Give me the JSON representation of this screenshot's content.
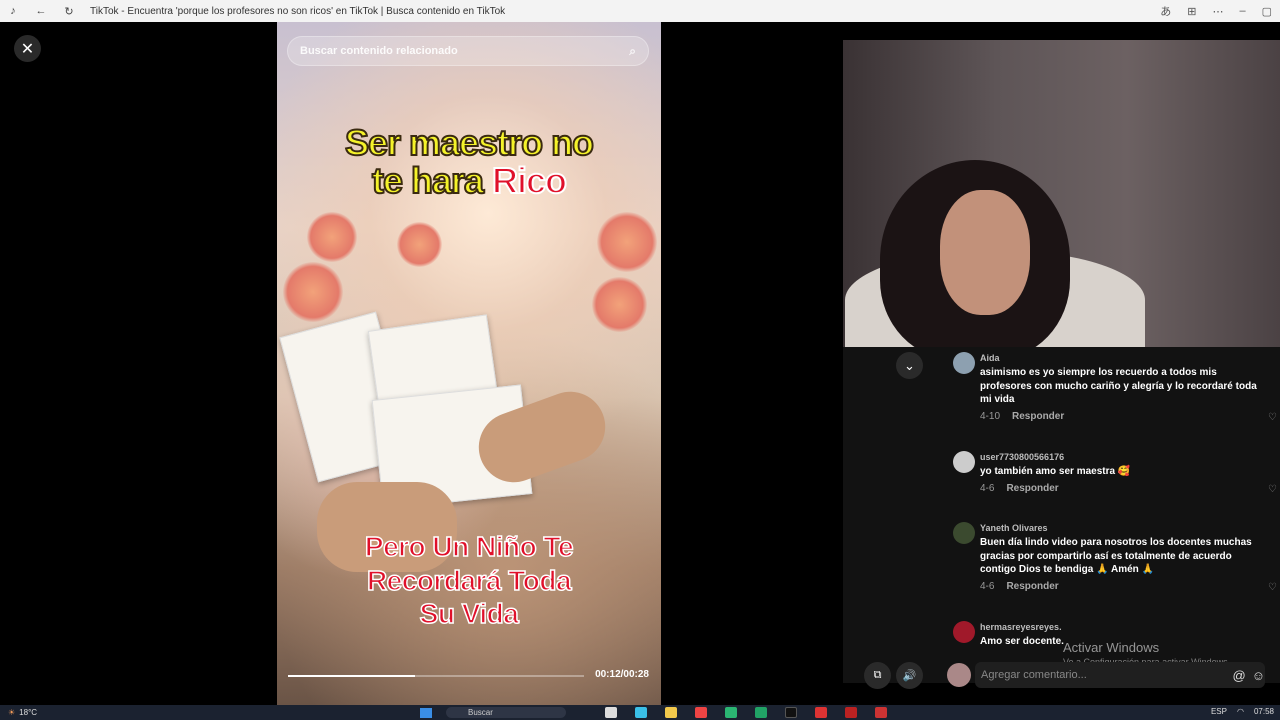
{
  "window": {
    "title": "TikTok - Encuentra 'porque los profesores no son ricos' en TikTok | Busca contenido en TikTok"
  },
  "video": {
    "search_placeholder": "Buscar contenido relacionado",
    "caption_top_line1": "Ser maestro no",
    "caption_top_line2_a": "te hara ",
    "caption_top_line2_b": "Rico",
    "caption_bottom_line1": "Pero Un Niño Te",
    "caption_bottom_line2": "Recordará Toda",
    "caption_bottom_line3": "Su Vida",
    "time": "00:12/00:28",
    "progress_fraction": 0.43
  },
  "comments": [
    {
      "user": "Aida",
      "text": "asimismo es yo siempre los recuerdo a todos mis profesores con mucho cariño y alegría y lo recordaré toda mi vida",
      "date": "4-10",
      "reply": "Responder"
    },
    {
      "user": "user7730800566176",
      "text": "yo también amo ser maestra 🥰",
      "date": "4-6",
      "reply": "Responder"
    },
    {
      "user": "Yaneth Olivares",
      "text": "Buen día lindo video para nosotros los docentes muchas gracias por compartirlo así es totalmente de acuerdo contigo Dios te bendiga 🙏 Amén 🙏",
      "date": "4-6",
      "reply": "Responder"
    },
    {
      "user": "hermasreyesreyes.",
      "text": "Amo ser docente."
    }
  ],
  "comment_input": {
    "placeholder": "Agregar comentario..."
  },
  "windows_watermark": {
    "line1": "Activar Windows",
    "line2": "Ve a Configuración para activar Windows."
  },
  "taskbar": {
    "weather": "18°C",
    "search": "Buscar",
    "lang": "ESP",
    "time": "07:58"
  },
  "colors": {
    "accent_red": "#e0102a",
    "caption_yellow": "#f5f32a"
  }
}
